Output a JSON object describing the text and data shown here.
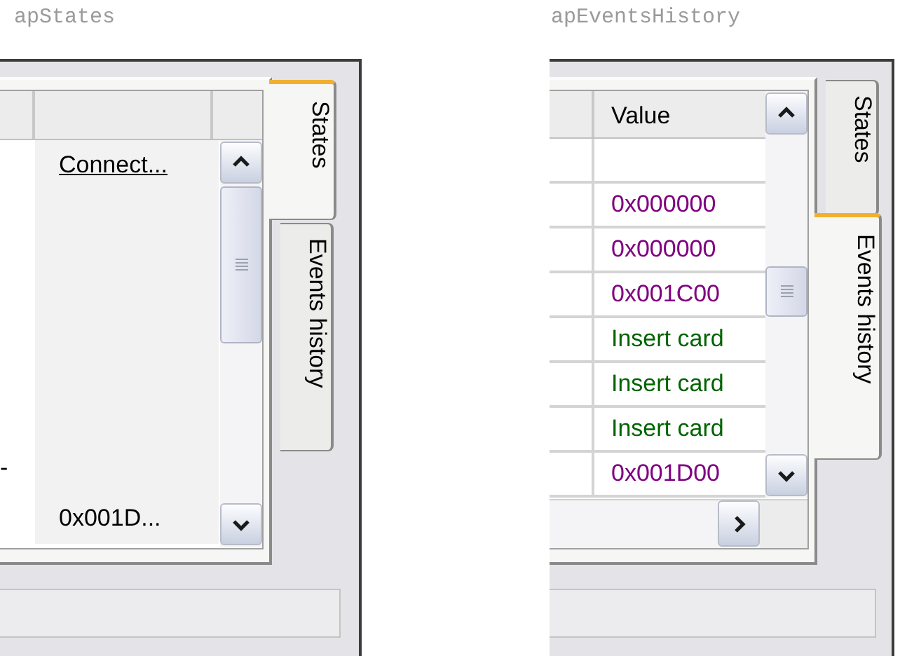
{
  "panels": [
    {
      "caption": "apStates",
      "kind": "states",
      "tabs": [
        {
          "label": "States",
          "selected": true
        },
        {
          "label": "Events history",
          "selected": false
        }
      ],
      "rows": [
        {
          "kind": "link",
          "column_2": "Connect..."
        },
        {
          "kind": "plain"
        },
        {
          "kind": "plain"
        },
        {
          "kind": "plain"
        },
        {
          "kind": "plain"
        },
        {
          "kind": "plain"
        },
        {
          "kind": "plain",
          "column_1": "-"
        },
        {
          "kind": "plain",
          "column_2": "0x001D..."
        }
      ]
    },
    {
      "caption": "apEventsHistory",
      "kind": "events",
      "tabs": [
        {
          "label": "States",
          "selected": false
        },
        {
          "label": "Events history",
          "selected": true
        }
      ],
      "value_header": "Value",
      "rows": [
        {
          "kind": "blank"
        },
        {
          "kind": "entry",
          "value": "0x000000",
          "color": "#800080"
        },
        {
          "kind": "entry",
          "value": "0x000000",
          "color": "#800080"
        },
        {
          "kind": "entry",
          "value": "0x001C00",
          "color": "#800080"
        },
        {
          "kind": "entry",
          "value": "Insert card",
          "color": "#006400"
        },
        {
          "kind": "entry",
          "value": "Insert card",
          "color": "#006400"
        },
        {
          "kind": "entry",
          "value": "Insert card",
          "color": "#006400"
        },
        {
          "kind": "entry",
          "value": "0x001D00",
          "color": "#800080"
        }
      ]
    }
  ]
}
